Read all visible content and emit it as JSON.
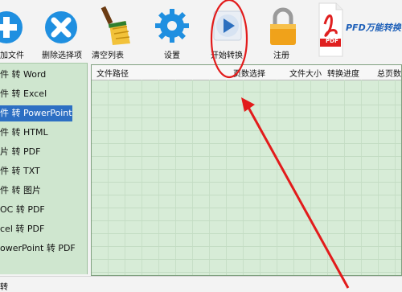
{
  "toolbar": {
    "add_file": "加文件",
    "delete_selected": "删除选择项",
    "clear_list": "清空列表",
    "settings": "设置",
    "start_convert": "开始转换",
    "register": "注册",
    "brand": "PFD万能转换",
    "pdf_badge": "PDF"
  },
  "sidebar": {
    "items": [
      {
        "label": "件 转 Word"
      },
      {
        "label": "件 转 Excel"
      },
      {
        "label": "件 转 PowerPoint"
      },
      {
        "label": "件 转 HTML"
      },
      {
        "label": "片 转 PDF"
      },
      {
        "label": "件 转 TXT"
      },
      {
        "label": "件 转 图片"
      },
      {
        "label": "OC 转 PDF"
      },
      {
        "label": "cel 转 PDF"
      },
      {
        "label": "owerPoint 转 PDF"
      }
    ]
  },
  "table": {
    "columns": [
      "文件路径",
      "页数选择",
      "文件大小",
      "转换进度",
      "总页数"
    ]
  },
  "statusbar": {
    "text": "转"
  },
  "colors": {
    "accent_blue": "#2d6fc3",
    "panel_green": "#d7ecd7",
    "annotation_red": "#e21b1b"
  }
}
